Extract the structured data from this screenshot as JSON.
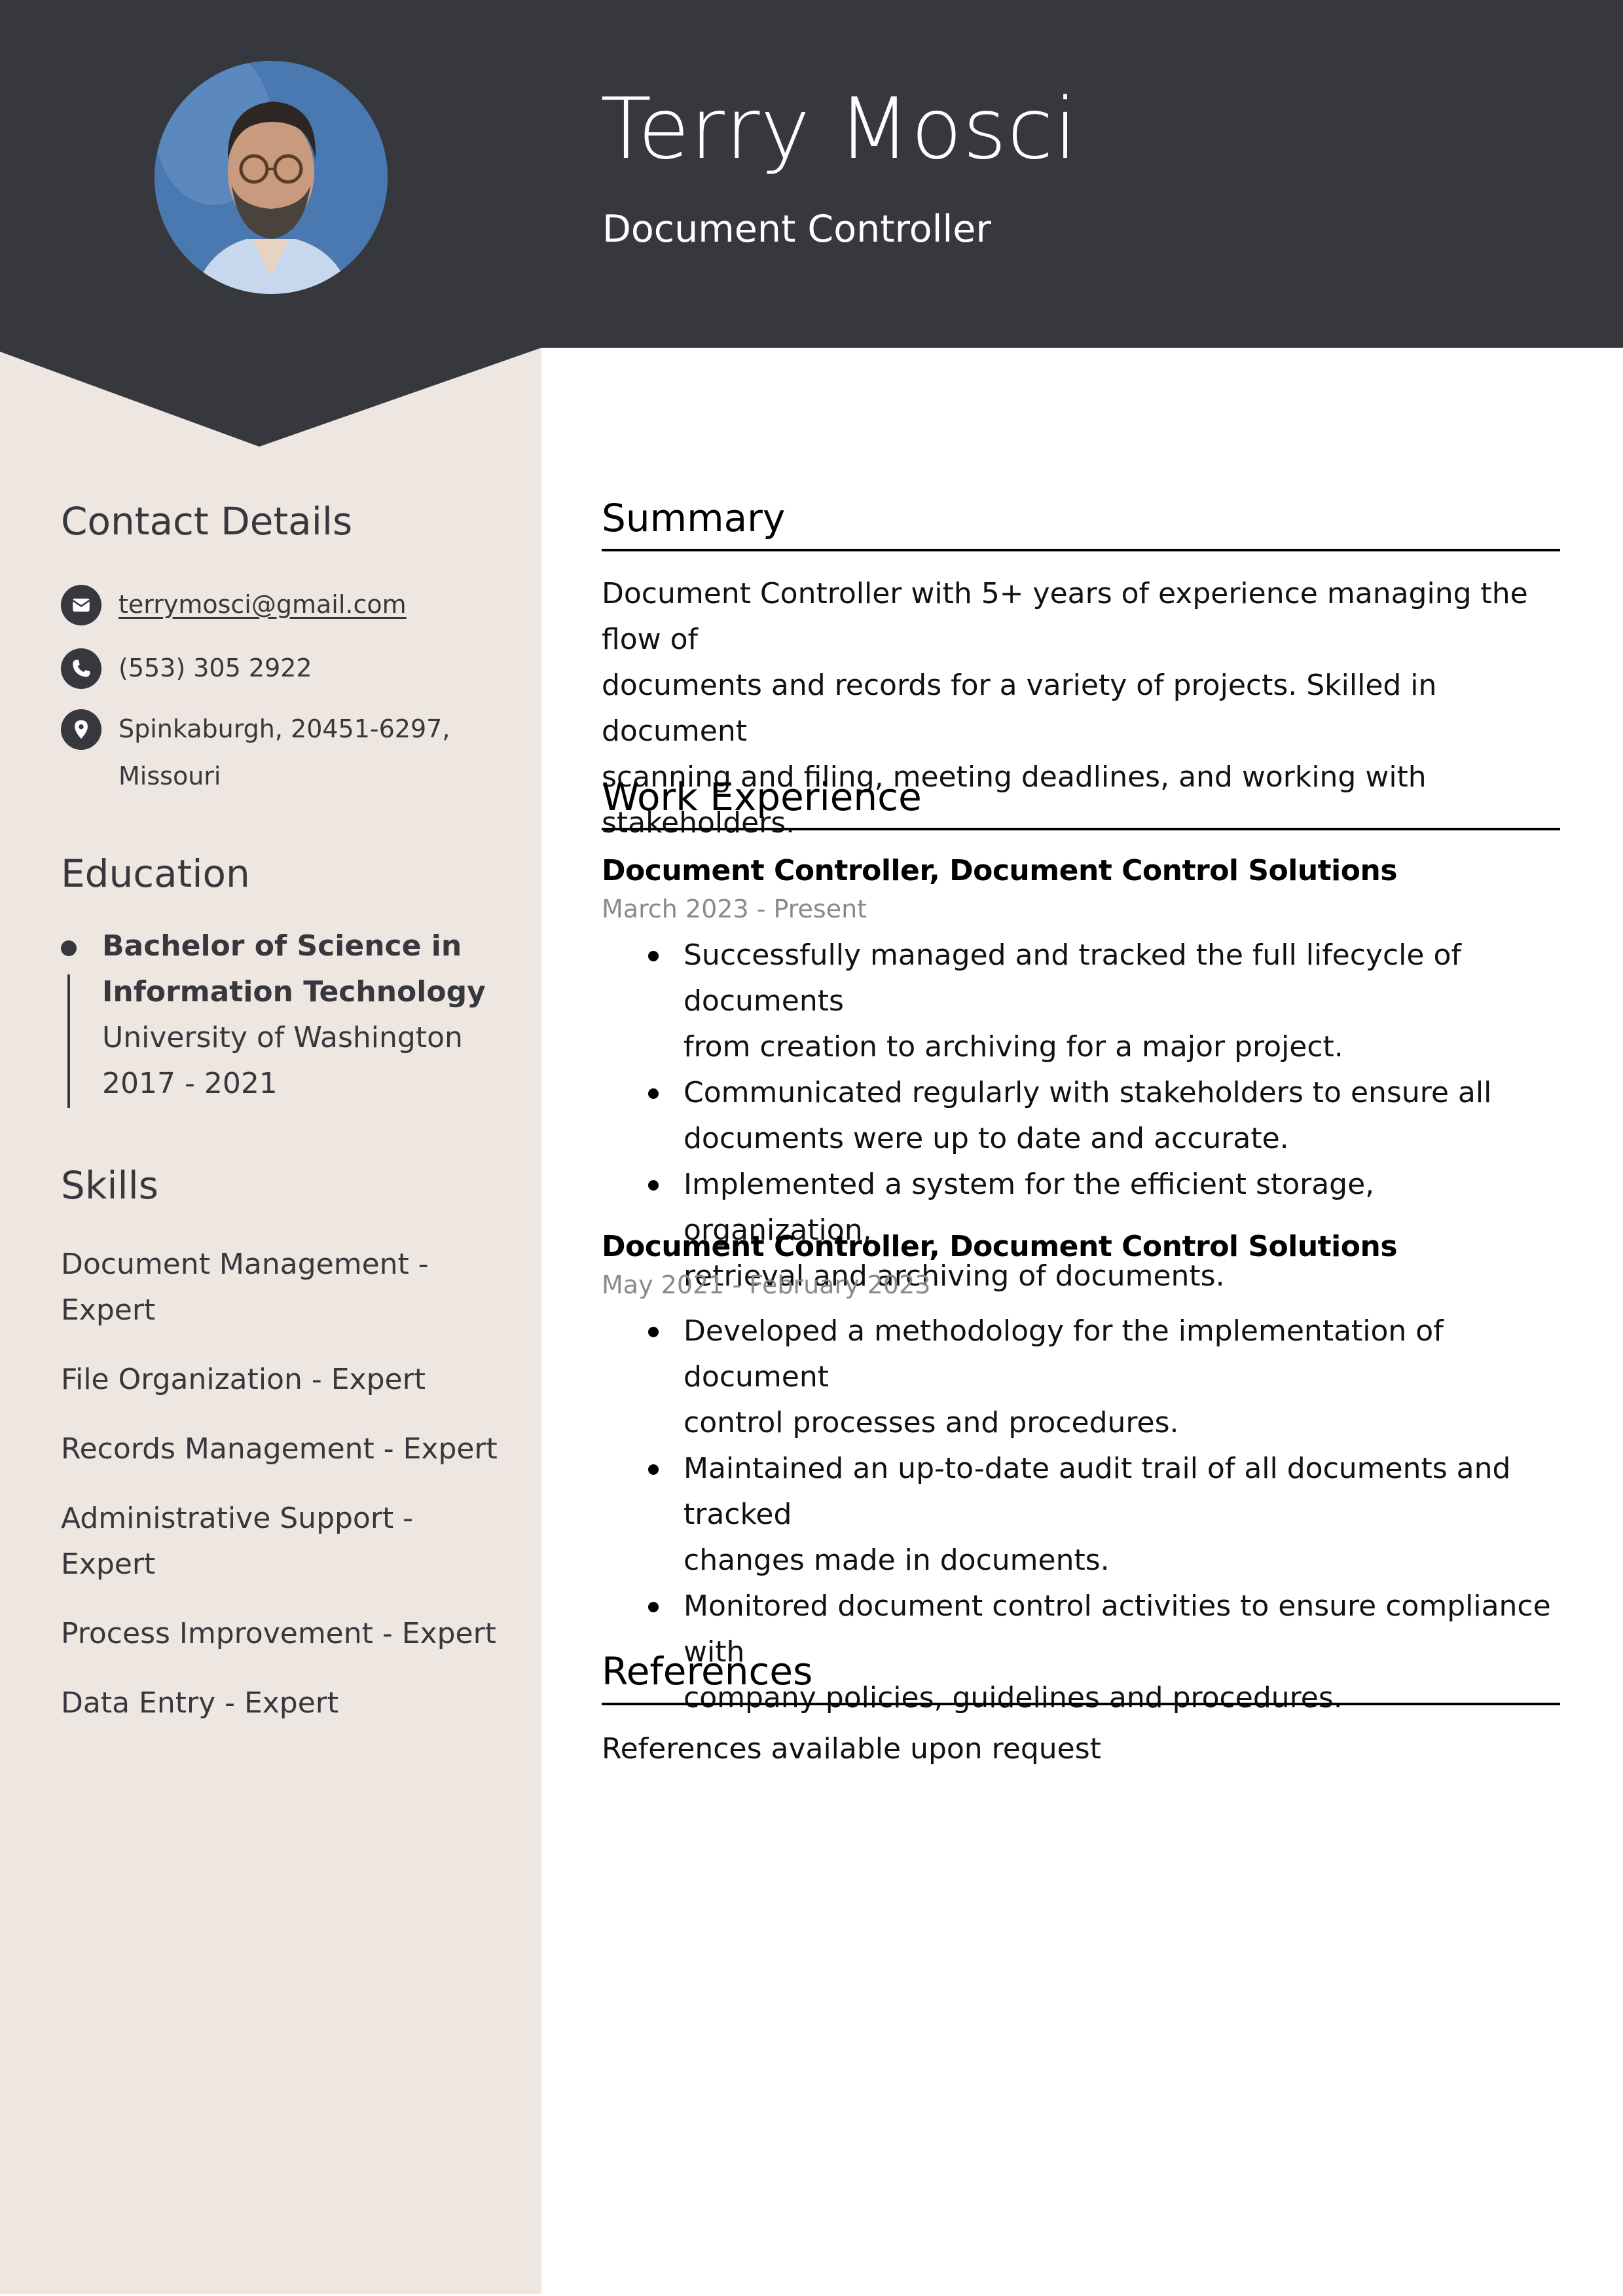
{
  "header": {
    "name": "Terry Mosci",
    "title": "Document Controller"
  },
  "colors": {
    "header_bg": "#37383e",
    "sidebar_bg": "#ede6e1",
    "text_dark": "#37383e",
    "date_gray": "#8a8a8a"
  },
  "sidebar": {
    "contact": {
      "heading": "Contact Details",
      "items": [
        {
          "icon": "envelope-icon",
          "text": "terrymosci@gmail.com"
        },
        {
          "icon": "phone-icon",
          "text": "(553) 305 2922"
        },
        {
          "icon": "location-pin-icon",
          "line1": "Spinkaburgh, 20451-6297,",
          "line2": "Missouri"
        }
      ]
    },
    "education": {
      "heading": "Education",
      "degree_line1": "Bachelor of Science in",
      "degree_line2": "Information Technology",
      "school": "University of Washington",
      "years": "2017 - 2021"
    },
    "skills": {
      "heading": "Skills",
      "items": [
        {
          "line1": "Document Management -",
          "line2": "Expert"
        },
        {
          "line1": "File Organization - Expert"
        },
        {
          "line1": "Records Management - Expert"
        },
        {
          "line1": "Administrative Support -",
          "line2": "Expert"
        },
        {
          "line1": "Process Improvement - Expert"
        },
        {
          "line1": "Data Entry - Expert"
        }
      ]
    }
  },
  "main": {
    "summary": {
      "heading": "Summary",
      "lines": [
        "Document Controller with 5+ years of experience managing the flow of",
        "documents and records for a variety of projects. Skilled in document",
        "scanning and filing, meeting deadlines, and working with stakeholders."
      ]
    },
    "work": {
      "heading": "Work Experience",
      "jobs": [
        {
          "title": "Document Controller, Document Control Solutions",
          "dates": "March 2023 - Present",
          "bullets": [
            [
              "Successfully managed and tracked the full lifecycle of documents",
              "from creation to archiving for a major project."
            ],
            [
              "Communicated regularly with stakeholders to ensure all",
              "documents were up to date and accurate."
            ],
            [
              "Implemented a system for the efficient storage, organization,",
              "retrieval and archiving of documents."
            ]
          ]
        },
        {
          "title": "Document Controller, Document Control Solutions",
          "dates": "May 2021 - February 2023",
          "bullets": [
            [
              "Developed a methodology for the implementation of document",
              "control processes and procedures."
            ],
            [
              "Maintained an up-to-date audit trail of all documents and tracked",
              "changes made in documents."
            ],
            [
              "Monitored document control activities to ensure compliance with",
              "company policies, guidelines and procedures."
            ]
          ]
        }
      ]
    },
    "references": {
      "heading": "References",
      "text": "References available upon request"
    }
  }
}
